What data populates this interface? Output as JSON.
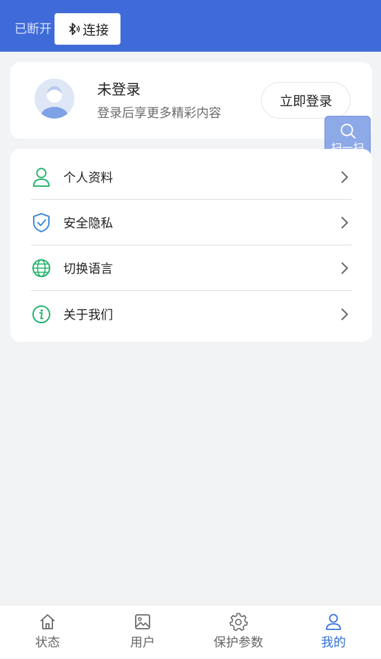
{
  "header": {
    "status": "已断开",
    "connect_label": "连接"
  },
  "profile": {
    "name": "未登录",
    "subtitle": "登录后享更多精彩内容",
    "login_label": "立即登录"
  },
  "scan": {
    "label": "扫一扫"
  },
  "menu": {
    "items": [
      {
        "label": "个人资料",
        "icon": "user-icon"
      },
      {
        "label": "安全隐私",
        "icon": "shield-check-icon"
      },
      {
        "label": "切换语言",
        "icon": "globe-icon"
      },
      {
        "label": "关于我们",
        "icon": "info-icon"
      }
    ]
  },
  "tabbar": {
    "tabs": [
      {
        "label": "状态",
        "icon": "home-icon",
        "active": false
      },
      {
        "label": "用户",
        "icon": "image-icon",
        "active": false
      },
      {
        "label": "保护参数",
        "icon": "gear-icon",
        "active": false
      },
      {
        "label": "我的",
        "icon": "user-icon",
        "active": true
      }
    ]
  },
  "colors": {
    "header_bg": "#3f6bd8",
    "accent": "#2f6fdc",
    "icon_green": "#22b36b",
    "icon_blue": "#3f8ad8"
  }
}
